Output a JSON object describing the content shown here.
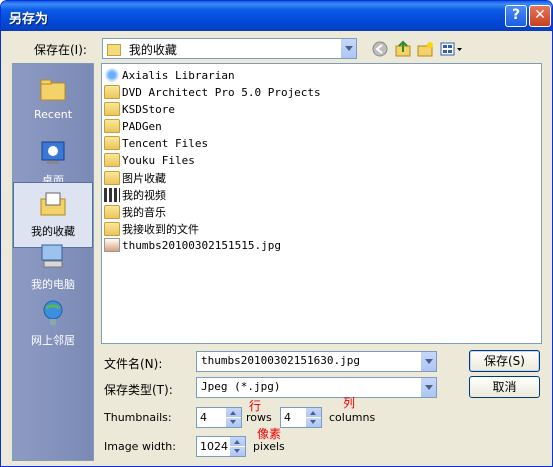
{
  "window": {
    "title": "另存为",
    "help_glyph": "?",
    "close_glyph": "✕"
  },
  "toolbar": {
    "save_in_label": "保存在(I):",
    "location": "我的收藏",
    "icons": [
      "back-icon",
      "up-folder-icon",
      "new-folder-icon",
      "views-menu-icon"
    ]
  },
  "places": [
    {
      "label": "Recent",
      "icon": "recent-icon"
    },
    {
      "label": "桌面",
      "icon": "desktop-icon"
    },
    {
      "label": "我的收藏",
      "icon": "my-documents-icon",
      "active": true
    },
    {
      "label": "我的电脑",
      "icon": "my-computer-icon"
    },
    {
      "label": "网上邻居",
      "icon": "network-icon"
    }
  ],
  "files": [
    {
      "name": "Axialis Librarian",
      "type": "app"
    },
    {
      "name": "DVD Architect Pro 5.0 Projects",
      "type": "folder"
    },
    {
      "name": "KSDStore",
      "type": "folder"
    },
    {
      "name": "PADGen",
      "type": "folder"
    },
    {
      "name": "Tencent Files",
      "type": "folder"
    },
    {
      "name": "Youku Files",
      "type": "folder"
    },
    {
      "name": "图片收藏",
      "type": "pictures"
    },
    {
      "name": "我的视频",
      "type": "video"
    },
    {
      "name": "我的音乐",
      "type": "music"
    },
    {
      "name": "我接收到的文件",
      "type": "folder"
    },
    {
      "name": "thumbs20100302151515.jpg",
      "type": "image"
    }
  ],
  "form": {
    "filename_label": "文件名(N):",
    "filename_value": "thumbs20100302151630.jpg",
    "filetype_label": "保存类型(T):",
    "filetype_value": "Jpeg (*.jpg)",
    "save_button": "保存(S)",
    "cancel_button": "取消"
  },
  "options": {
    "thumbnails_label": "Thumbnails:",
    "rows_value": "4",
    "rows_label": "rows",
    "columns_value": "4",
    "columns_label": "columns",
    "image_width_label": "Image width:",
    "image_width_value": "1024",
    "pixels_label": "pixels"
  },
  "annotations": {
    "rows_note": "行",
    "columns_note": "列",
    "pixels_note": "像素"
  }
}
